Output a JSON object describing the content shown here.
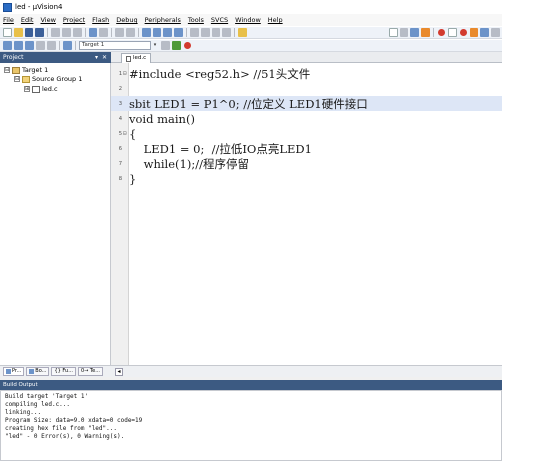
{
  "window": {
    "title": "led - µVision4"
  },
  "menu": [
    "File",
    "Edit",
    "View",
    "Project",
    "Flash",
    "Debug",
    "Peripherals",
    "Tools",
    "SVCS",
    "Window",
    "Help"
  ],
  "toolbar": {
    "target_select": "Target 1"
  },
  "project_panel": {
    "title": "Project",
    "controls": "▾ ✕",
    "tree": [
      {
        "label": "Target 1",
        "level": 0,
        "icon": "target-icon",
        "expander": "⊟"
      },
      {
        "label": "Source Group 1",
        "level": 1,
        "icon": "folder-icon",
        "expander": "⊟"
      },
      {
        "label": "led.c",
        "level": 2,
        "icon": "file-icon",
        "expander": "⊞"
      }
    ],
    "tabs": [
      "Pr...",
      "Bo...",
      "{} Fu...",
      "0→ Te..."
    ]
  },
  "editor": {
    "tab": "led.c",
    "lines": [
      {
        "num": "1",
        "fold": "⊟",
        "text": "#include <reg52.h> //51头文件"
      },
      {
        "num": "2",
        "fold": "",
        "text": ""
      },
      {
        "num": "3",
        "fold": "",
        "text": "sbit LED1 = P1^0; //位定义 LED1硬件接口"
      },
      {
        "num": "4",
        "fold": "",
        "text": "void main()"
      },
      {
        "num": "5",
        "fold": "⊟",
        "text": "{"
      },
      {
        "num": "6",
        "fold": "",
        "text": "    LED1 = 0;  //拉低IO点亮LED1"
      },
      {
        "num": "7",
        "fold": "",
        "text": "    while(1);//程序停留"
      },
      {
        "num": "8",
        "fold": "",
        "text": "}"
      }
    ],
    "highlighted_line": "3"
  },
  "build_output": {
    "title": "Build Output",
    "lines": [
      "Build target 'Target 1'",
      "compiling led.c...",
      "linking...",
      "Program Size: data=9.0 xdata=0 code=19",
      "creating hex file from \"led\"...",
      "\"led\" - 0 Error(s), 0 Warning(s)."
    ]
  },
  "colors": {
    "panel_header": "#3c5a82",
    "highlight_line": "#dde6f6",
    "comment": "#2e7d32"
  }
}
